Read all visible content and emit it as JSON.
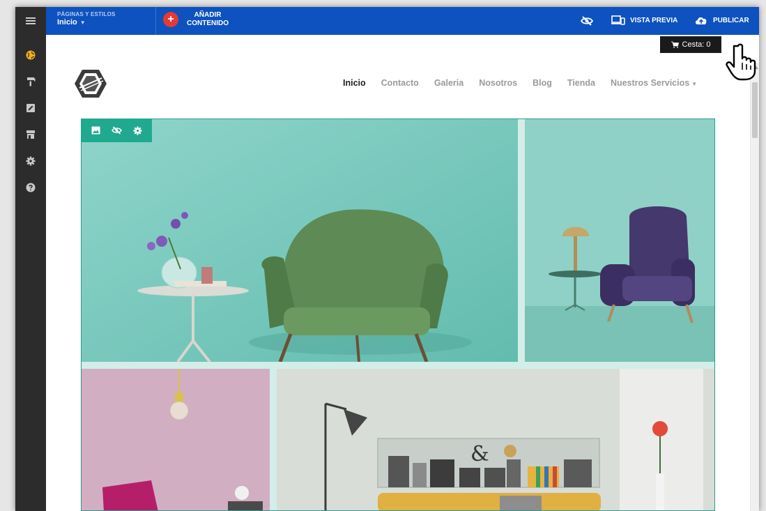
{
  "topbar": {
    "pages_label": "PÁGINAS Y ESTILOS",
    "current_page": "Inicio",
    "add_content_line1": "AÑADIR",
    "add_content_line2": "CONTENIDO",
    "preview_label": "VISTA PREVIA",
    "publish_label": "PUBLICAR"
  },
  "sidebar": {
    "items": [
      {
        "icon": "globe-icon"
      },
      {
        "icon": "paint-roller-icon"
      },
      {
        "icon": "edit-text-icon"
      },
      {
        "icon": "store-icon"
      },
      {
        "icon": "gear-icon"
      },
      {
        "icon": "help-icon"
      }
    ]
  },
  "site": {
    "cart_label": "Cesta: 0",
    "nav": [
      {
        "label": "Inicio",
        "active": true
      },
      {
        "label": "Contacto"
      },
      {
        "label": "Galeria"
      },
      {
        "label": "Nosotros"
      },
      {
        "label": "Blog"
      },
      {
        "label": "Tienda"
      },
      {
        "label": "Nuestros Servicios",
        "dropdown": true
      }
    ]
  },
  "colors": {
    "topbar": "#0d52bf",
    "sidebar": "#2c2c2c",
    "accent_green": "#20a98f",
    "add_button": "#e53935",
    "active_icon": "#f2b01e"
  }
}
